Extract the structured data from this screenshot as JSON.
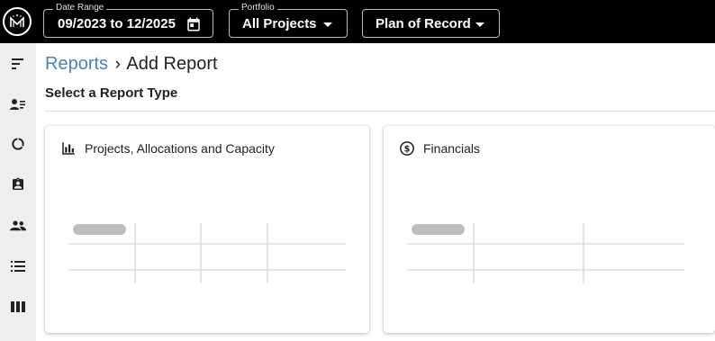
{
  "topbar": {
    "logo_icon": "logo-icon",
    "date_range": {
      "legend": "Date Range",
      "value": "09/2023 to 12/2025",
      "icon": "calendar-icon"
    },
    "portfolio": {
      "legend": "Portfolio",
      "value": "All Projects",
      "icon": "caret-down-icon"
    },
    "plan": {
      "value": "Plan of Record",
      "icon": "caret-down-icon"
    }
  },
  "sidebar": {
    "items": [
      {
        "icon": "menu-toggle-icon"
      },
      {
        "icon": "people-list-icon"
      },
      {
        "icon": "donut-chart-icon"
      },
      {
        "icon": "assignment-ind-icon"
      },
      {
        "icon": "group-icon"
      },
      {
        "icon": "list-icon"
      },
      {
        "icon": "columns-icon"
      }
    ]
  },
  "breadcrumb": {
    "parent": "Reports",
    "separator": "›",
    "current": "Add Report"
  },
  "section": {
    "title": "Select a Report Type"
  },
  "report_types": [
    {
      "label": "Projects, Allocations and Capacity",
      "icon": "bar-chart-icon"
    },
    {
      "label": "Financials",
      "icon": "dollar-circle-icon"
    }
  ],
  "colors": {
    "topbar": "#000000",
    "sidebar": "#eeeeee",
    "link": "#4a82b4",
    "placeholder": "#bdbdbd"
  }
}
